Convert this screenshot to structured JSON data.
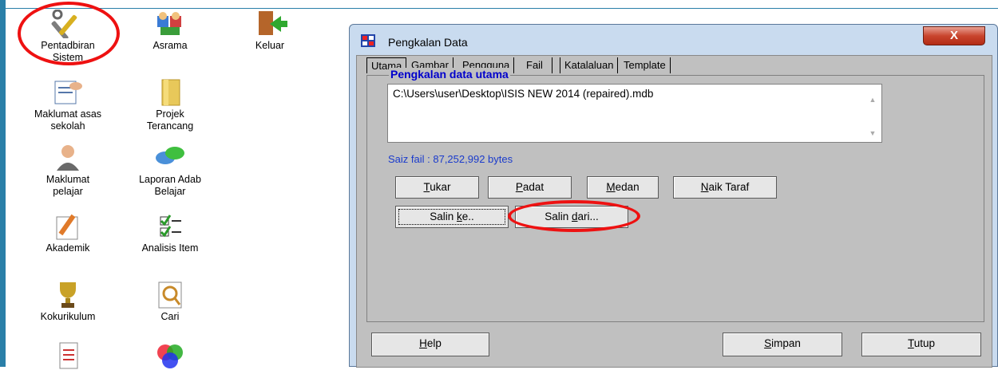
{
  "desktop": {
    "icons": [
      {
        "label": "Pentadbiran\nSistem"
      },
      {
        "label": "Asrama"
      },
      {
        "label": "Keluar"
      },
      {
        "label": "Maklumat asas\nsekolah"
      },
      {
        "label": "Projek\nTerancang"
      },
      {
        "label": "Maklumat\npelajar"
      },
      {
        "label": "Laporan Adab\nBelajar"
      },
      {
        "label": "Akademik"
      },
      {
        "label": "Analisis Item"
      },
      {
        "label": "Kokurikulum"
      },
      {
        "label": "Cari"
      }
    ]
  },
  "dialog": {
    "title": "Pengkalan Data",
    "close_label": "X",
    "tabs": [
      "Utama",
      "Gambar",
      "Pengguna",
      "Fail",
      "Katalaluan",
      "Template"
    ],
    "group_label": "Pengkalan data utama",
    "db_path": "C:\\Users\\user\\Desktop\\ISIS NEW 2014 (repaired).mdb",
    "file_size": "Saiz fail : 87,252,992 bytes",
    "buttons": {
      "tukar": {
        "first": "T",
        "rest": "ukar"
      },
      "padat": {
        "first": "P",
        "rest": "adat"
      },
      "medan": {
        "first": "M",
        "rest": "edan"
      },
      "naik_taraf": {
        "first": "N",
        "rest": "aik Taraf"
      },
      "salin_ke": {
        "pre": "Salin ",
        "u": "k",
        "post": "e.."
      },
      "salin_dari": {
        "pre": "Salin ",
        "u": "d",
        "post": "ari..."
      },
      "help": {
        "first": "H",
        "rest": "elp"
      },
      "simpan": {
        "first": "S",
        "rest": "impan"
      },
      "tutup": {
        "first": "T",
        "rest": "utup"
      }
    }
  },
  "colors": {
    "highlight": "#e11111",
    "link_blue": "#0000cc",
    "file_size_blue": "#1a3bcc"
  }
}
